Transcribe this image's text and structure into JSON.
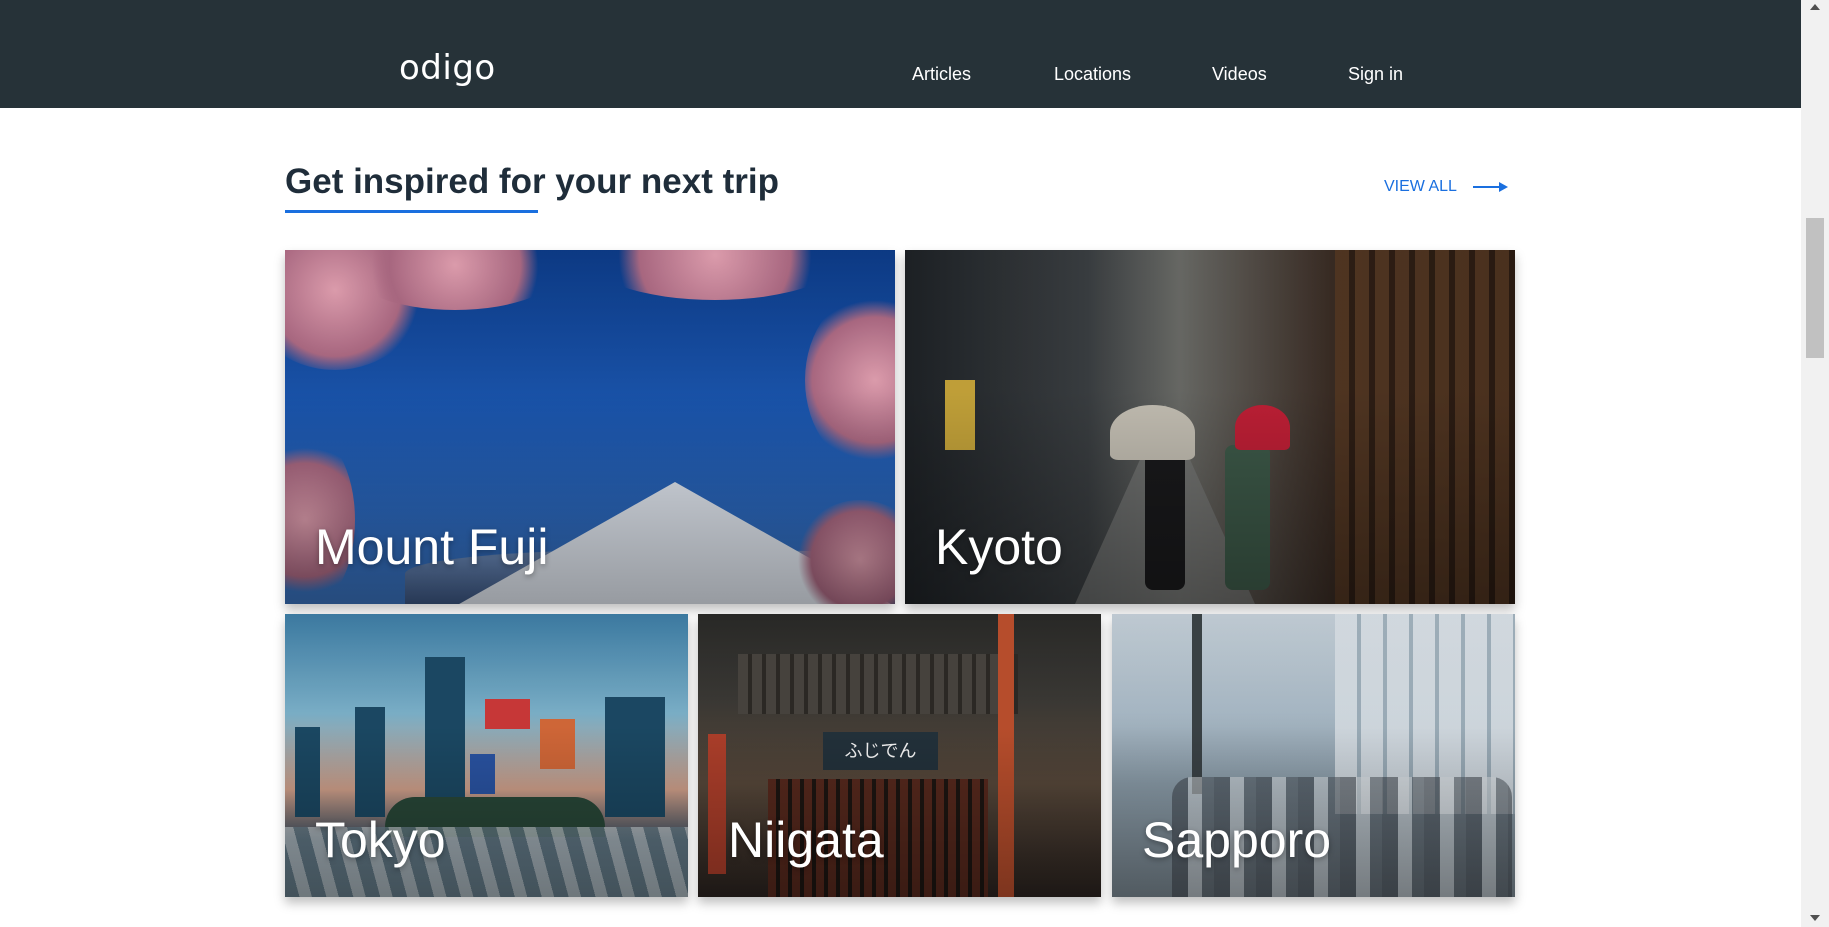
{
  "header": {
    "logo": "odigo",
    "nav": [
      {
        "label": "Articles"
      },
      {
        "label": "Locations"
      },
      {
        "label": "Videos"
      },
      {
        "label": "Sign in"
      }
    ]
  },
  "section": {
    "title": "Get inspired for your next trip",
    "view_all": "VIEW ALL",
    "view_all_icon": "arrow-right-icon"
  },
  "destinations": [
    {
      "name": "Mount Fuji"
    },
    {
      "name": "Kyoto"
    },
    {
      "name": "Tokyo"
    },
    {
      "name": "Niigata"
    },
    {
      "name": "Sapporo"
    }
  ],
  "colors": {
    "navbar": "#263238",
    "accent": "#1a6fdf",
    "title": "#1f2d3a"
  }
}
